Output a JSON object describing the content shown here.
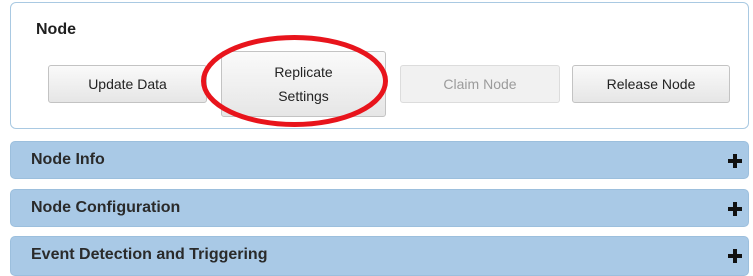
{
  "node_panel": {
    "title": "Node",
    "buttons": {
      "update_data": "Update Data",
      "replicate_line1": "Replicate",
      "replicate_line2": "Settings",
      "claim_node": "Claim Node",
      "release_node": "Release Node"
    },
    "claim_node_disabled": true,
    "highlight_color": "#e8141c"
  },
  "accordions": [
    {
      "label": "Node Info",
      "icon": "plus-icon"
    },
    {
      "label": "Node Configuration",
      "icon": "plus-icon"
    },
    {
      "label": "Event Detection and Triggering",
      "icon": "plus-icon"
    }
  ],
  "colors": {
    "accordion_bg": "#a9c9e6",
    "panel_border": "#a9c9e2"
  }
}
